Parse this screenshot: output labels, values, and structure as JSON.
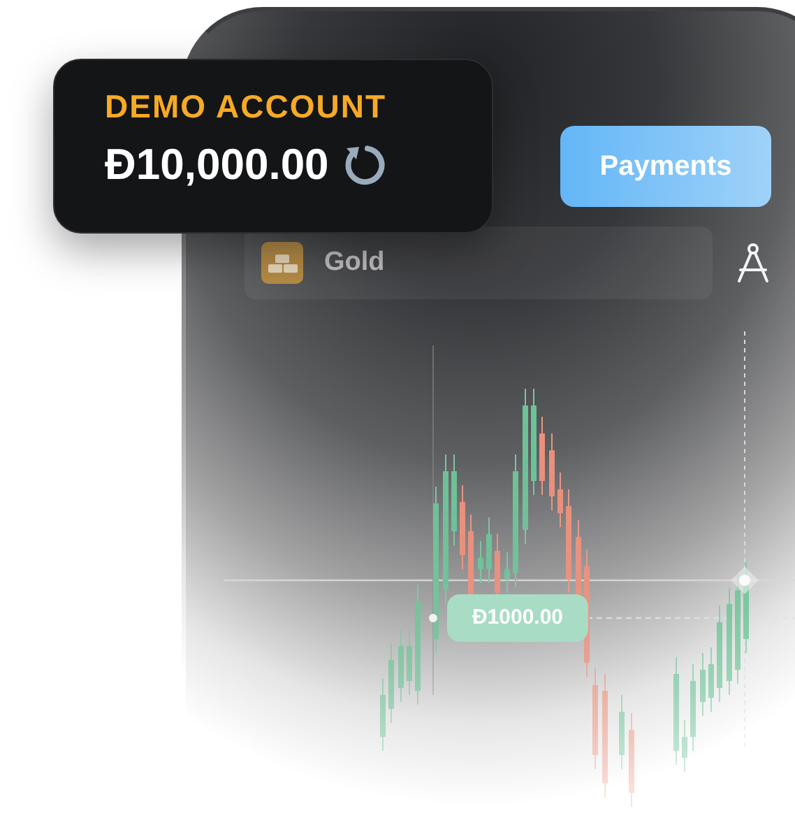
{
  "balance_card": {
    "label": "DEMO ACCOUNT",
    "amount": "Đ10,000.00"
  },
  "payments_button": {
    "label": "Payments"
  },
  "asset": {
    "name": "Gold"
  },
  "price_tag": {
    "label": "Đ1000.00"
  }
}
